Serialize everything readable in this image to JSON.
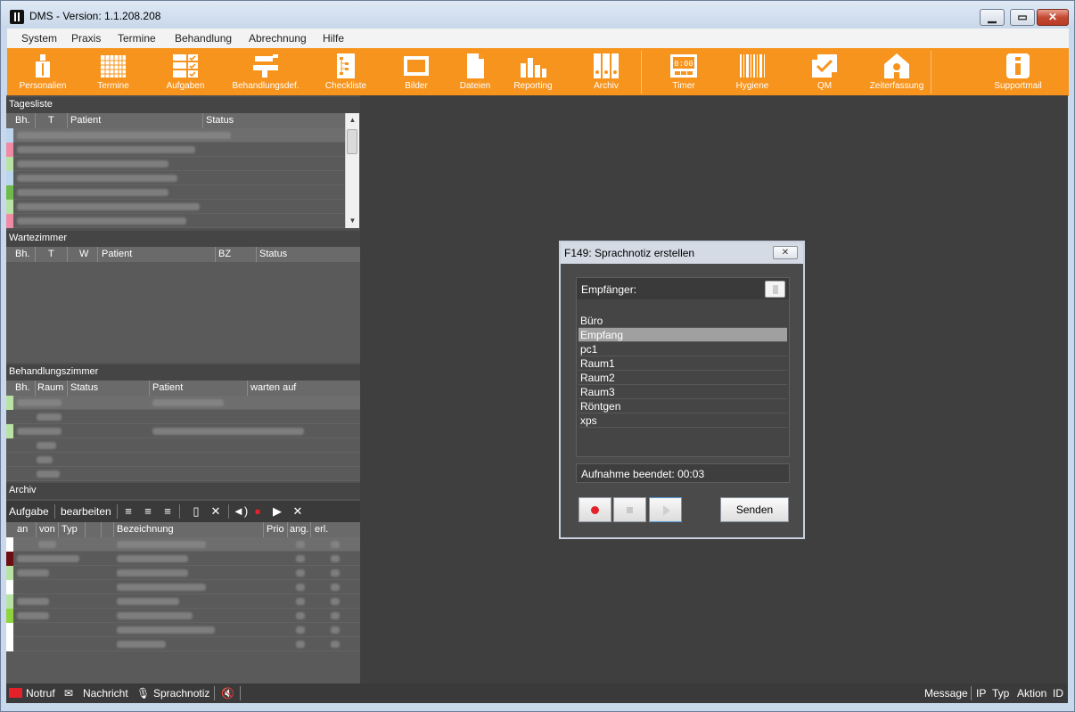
{
  "window": {
    "title": "DMS  -  Version: 1.1.208.208"
  },
  "menu": [
    "System",
    "Praxis",
    "Termine",
    "Behandlung",
    "Abrechnung",
    "Hilfe"
  ],
  "toolbar": [
    {
      "label": "Personalien",
      "icon": "person-icon"
    },
    {
      "label": "Termine",
      "icon": "calendar-icon"
    },
    {
      "label": "Aufgaben",
      "icon": "tasks-icon"
    },
    {
      "label": "Behandlungsdef.",
      "icon": "dental-chair-icon"
    },
    {
      "label": "Checkliste",
      "icon": "checklist-icon"
    },
    {
      "label": "Bilder",
      "icon": "pictures-icon"
    },
    {
      "label": "Dateien",
      "icon": "file-icon"
    },
    {
      "label": "Reporting",
      "icon": "bar-chart-icon"
    },
    {
      "label": "Archiv",
      "icon": "archive-icon"
    },
    {
      "label": "Timer",
      "icon": "timer-icon"
    },
    {
      "label": "Hygiene",
      "icon": "barcode-icon"
    },
    {
      "label": "QM",
      "icon": "qm-icon"
    },
    {
      "label": "Zeiterfassung",
      "icon": "time-clock-house-icon"
    },
    {
      "label": "Supportmail",
      "icon": "info-icon"
    }
  ],
  "tagesliste": {
    "title": "Tagesliste",
    "columns": [
      "Bh.",
      "T",
      "Patient",
      "Status"
    ],
    "row_colors": [
      "#bcd6f0",
      "#f08aa5",
      "#b9e3a5",
      "#bcd6f0",
      "#6dbb4a",
      "#b9e3a5",
      "#f08aa5"
    ]
  },
  "wartezimmer": {
    "title": "Wartezimmer",
    "columns": [
      "Bh.",
      "T",
      "W",
      "Patient",
      "BZ",
      "Status"
    ]
  },
  "behandlungszimmer": {
    "title": "Behandlungszimmer",
    "columns": [
      "Bh.",
      "Raum",
      "Status",
      "Patient",
      "warten auf"
    ],
    "row_colors": [
      "#b9e3a5",
      "#5a5a5a",
      "#b9e3a5",
      "#5a5a5a",
      "#5a5a5a",
      "#5a5a5a"
    ]
  },
  "archiv": {
    "title": "Archiv",
    "tab_aufgabe": "Aufgabe",
    "tab_bearbeiten": "bearbeiten",
    "columns": [
      "an",
      "von",
      "Typ",
      "Bezeichnung",
      "Prio",
      "ang.",
      "erl."
    ],
    "row_colors": [
      "#ffffff",
      "#6b0f12",
      "#b9e3a5",
      "#ffffff",
      "#b9e3a5",
      "#8ed43a",
      "#ffffff",
      "#ffffff"
    ]
  },
  "statusbar": {
    "notruf": "Notruf",
    "nachricht": "Nachricht",
    "sprachnotiz": "Sprachnotiz",
    "message": "Message",
    "ip": "IP",
    "typ": "Typ",
    "aktion": "Aktion",
    "id": "ID"
  },
  "dialog": {
    "title": "F149: Sprachnotiz erstellen",
    "recipient_header": "Empfänger:",
    "recipients": [
      "Büro",
      "Empfang",
      "pc1",
      "Raum1",
      "Raum2",
      "Raum3",
      "Röntgen",
      "xps"
    ],
    "selected_recipient": "Empfang",
    "record_status": "Aufnahme beendet: 00:03",
    "send_label": "Senden"
  },
  "colors": {
    "toolbar": "#f7941d",
    "workspace": "#3f3f3f",
    "notruf": "#e4202b"
  }
}
